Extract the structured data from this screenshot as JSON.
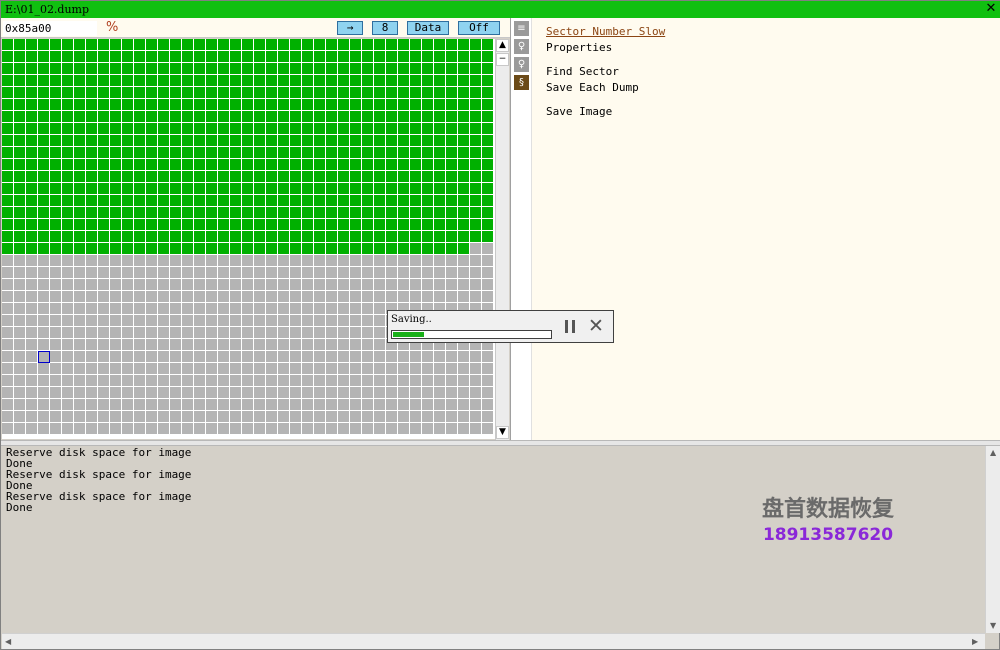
{
  "window": {
    "title": "E:\\01_02.dump",
    "close_glyph": "✕",
    "titlebar_color": "#10c010"
  },
  "toolbar": {
    "address_value": "0x85a00",
    "link_icon": "percent-link-icon",
    "arrow_label": "→",
    "count_label": "8",
    "data_label": "Data",
    "off_label": "Off",
    "button_color": "#8fd3f0"
  },
  "sector_map": {
    "columns": 41,
    "rows": 33,
    "read_full_rows": 17,
    "read_partial_row_cells": 39,
    "selected_cell": {
      "row": 26,
      "col": 3
    },
    "colors": {
      "read": "#00b000",
      "unread": "#b4b4b4",
      "grid_line": "#ffffff",
      "selected_border": "#0000cc"
    }
  },
  "grid_scrollbar": {
    "up": "▲",
    "minus": "−",
    "down": "▼"
  },
  "side_icons": [
    "list-icon",
    "bulb-icon",
    "bulb-outline-icon",
    "scroll-icon"
  ],
  "menu": {
    "sector_number_slow": "Sector Number Slow",
    "properties": "Properties",
    "find_sector": "Find Sector",
    "save_each_dump": "Save Each Dump",
    "save_image": "Save Image"
  },
  "progress": {
    "label": "Saving..",
    "percent": 20,
    "pause_icon": "pause-icon",
    "cancel_glyph": "✕"
  },
  "log": {
    "lines": [
      "Reserve disk space for image",
      "Done",
      "Reserve disk space for image",
      "Done",
      "Reserve disk space for image",
      "Done"
    ]
  },
  "log_scroll": {
    "up": "▲",
    "down": "▼",
    "left": "◀",
    "right": "▶"
  },
  "watermark": {
    "name": "盘首数据恢复",
    "phone": "18913587620"
  }
}
